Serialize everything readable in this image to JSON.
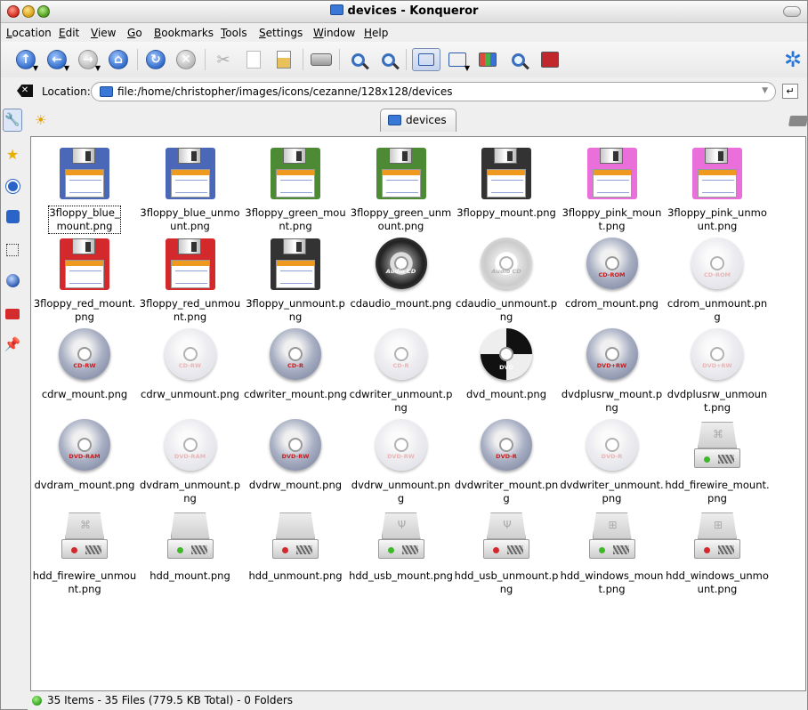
{
  "window": {
    "title": "devices - Konqueror"
  },
  "menu": [
    "Location",
    "Edit",
    "View",
    "Go",
    "Bookmarks",
    "Tools",
    "Settings",
    "Window",
    "Help"
  ],
  "toolbar": {
    "icons": [
      "up-icon",
      "back-icon",
      "forward-icon",
      "home-icon",
      "reload-icon",
      "stop-icon",
      "cut-icon",
      "copy-icon",
      "paste-icon",
      "print-icon",
      "zoom-in-icon",
      "zoom-out-icon",
      "icon-view-icon",
      "detail-view-icon",
      "tree-view-icon",
      "preview-icon",
      "split-icon",
      "konqueror-gear-icon"
    ]
  },
  "location": {
    "label": "Location:",
    "value": "file:/home/christopher/images/icons/cezanne/128x128/devices"
  },
  "tab": {
    "label": "devices"
  },
  "items": [
    {
      "name": "3floppy_blue_mount.png",
      "kind": "floppy",
      "color": "#4a67b8",
      "focused": true
    },
    {
      "name": "3floppy_blue_unmount.png",
      "kind": "floppy",
      "color": "#4a67b8"
    },
    {
      "name": "3floppy_green_mount.png",
      "kind": "floppy",
      "color": "#4d8a34"
    },
    {
      "name": "3floppy_green_unmount.png",
      "kind": "floppy",
      "color": "#4d8a34"
    },
    {
      "name": "3floppy_mount.png",
      "kind": "floppy",
      "color": "#333333"
    },
    {
      "name": "3floppy_pink_mount.png",
      "kind": "floppy",
      "color": "#ea6fda"
    },
    {
      "name": "3floppy_pink_unmount.png",
      "kind": "floppy",
      "color": "#ea6fda"
    },
    {
      "name": "3floppy_red_mount.png",
      "kind": "floppy",
      "color": "#d3282c"
    },
    {
      "name": "3floppy_red_unmount.png",
      "kind": "floppy",
      "color": "#d3282c"
    },
    {
      "name": "3floppy_unmount.png",
      "kind": "floppy",
      "color": "#333333"
    },
    {
      "name": "cdaudio_mount.png",
      "kind": "audiocd",
      "mounted": true,
      "disc_label": "Audio CD"
    },
    {
      "name": "cdaudio_unmount.png",
      "kind": "audiocd",
      "mounted": false,
      "disc_label": "Audio CD"
    },
    {
      "name": "cdrom_mount.png",
      "kind": "disc",
      "mounted": true,
      "disc_label": "CD-ROM"
    },
    {
      "name": "cdrom_unmount.png",
      "kind": "disc",
      "mounted": false,
      "disc_label": "CD-ROM"
    },
    {
      "name": "cdrw_mount.png",
      "kind": "disc",
      "mounted": true,
      "disc_label": "CD-RW"
    },
    {
      "name": "cdrw_unmount.png",
      "kind": "disc",
      "mounted": false,
      "disc_label": "CD-RW"
    },
    {
      "name": "cdwriter_mount.png",
      "kind": "disc",
      "mounted": true,
      "disc_label": "CD-R"
    },
    {
      "name": "cdwriter_unmount.png",
      "kind": "disc",
      "mounted": false,
      "disc_label": "CD-R"
    },
    {
      "name": "dvd_mount.png",
      "kind": "dvd",
      "mounted": true,
      "disc_label": "DVD"
    },
    {
      "name": "dvdplusrw_mount.png",
      "kind": "disc",
      "mounted": true,
      "disc_label": "DVD+RW"
    },
    {
      "name": "dvdplusrw_unmount.png",
      "kind": "disc",
      "mounted": false,
      "disc_label": "DVD+RW"
    },
    {
      "name": "dvdram_mount.png",
      "kind": "disc",
      "mounted": true,
      "disc_label": "DVD-RAM"
    },
    {
      "name": "dvdram_unmount.png",
      "kind": "disc",
      "mounted": false,
      "disc_label": "DVD-RAM"
    },
    {
      "name": "dvdrw_mount.png",
      "kind": "disc",
      "mounted": true,
      "disc_label": "DVD-RW"
    },
    {
      "name": "dvdrw_unmount.png",
      "kind": "disc",
      "mounted": false,
      "disc_label": "DVD-RW"
    },
    {
      "name": "dvdwriter_mount.png",
      "kind": "disc",
      "mounted": true,
      "disc_label": "DVD-R"
    },
    {
      "name": "dvdwriter_unmount.png",
      "kind": "disc",
      "mounted": false,
      "disc_label": "DVD-R"
    },
    {
      "name": "hdd_firewire_mount.png",
      "kind": "hdd",
      "led": "#3fb72a",
      "mark": "firewire"
    },
    {
      "name": "hdd_firewire_unmount.png",
      "kind": "hdd",
      "led": "#d3282c",
      "mark": "firewire"
    },
    {
      "name": "hdd_mount.png",
      "kind": "hdd",
      "led": "#3fb72a",
      "mark": ""
    },
    {
      "name": "hdd_unmount.png",
      "kind": "hdd",
      "led": "#d3282c",
      "mark": ""
    },
    {
      "name": "hdd_usb_mount.png",
      "kind": "hdd",
      "led": "#3fb72a",
      "mark": "usb"
    },
    {
      "name": "hdd_usb_unmount.png",
      "kind": "hdd",
      "led": "#d3282c",
      "mark": "usb"
    },
    {
      "name": "hdd_windows_mount.png",
      "kind": "hdd",
      "led": "#3fb72a",
      "mark": "windows"
    },
    {
      "name": "hdd_windows_unmount.png",
      "kind": "hdd",
      "led": "#d3282c",
      "mark": "windows"
    }
  ],
  "status": {
    "text": "35 Items - 35 Files (779.5 KB Total) - 0 Folders"
  }
}
